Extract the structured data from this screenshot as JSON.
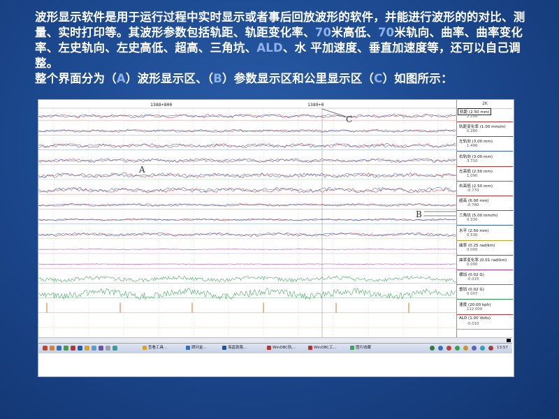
{
  "description": {
    "p1_a": "波形显示",
    "p1_b": "软件是用于运行过程中实时显示或者事后回放波形的软件，并能进行波形的的对比、测量、实时打印等。其波形参数包括轨距、轨距变化率、",
    "p1_c": "70",
    "p1_d": "米高低、",
    "p1_e": "70",
    "p1_f": "米轨向、曲率、曲率变化率、左史轨向、左史高低、超高、三角坑、",
    "p1_g": "ALD",
    "p1_h": "、水 平加速度、垂直加速度等，还可以自己调整。",
    "p2_a": "整个界面分为（",
    "p2_b": "A",
    "p2_c": "）波形显示区、（",
    "p2_d": "B",
    "p2_e": "）参数显示区和公里显示区（",
    "p2_f": "C",
    "p2_g": "）如图所示："
  },
  "screenshot": {
    "mileage_left": "1388+800",
    "mileage_right": "1389+0",
    "label_a": "A",
    "label_b": "B",
    "label_c": "C",
    "panel_header": "2K",
    "params": [
      {
        "label": "轨距 (2.50 mm)",
        "value": "2.150",
        "color": "#c03030"
      },
      {
        "label": "轨距变化率 (1.00 mm/m)",
        "value": "0.260",
        "color": "#c03030"
      },
      {
        "label": "左轨向 (3.00 mm)",
        "value": "1.490",
        "color": "#3060c0"
      },
      {
        "label": "右轨向 (3.00 mm)",
        "value": "3.710",
        "color": "#c03030"
      },
      {
        "label": "左高低 (2.50 mm)",
        "value": "1.090",
        "color": "#2a9a4a"
      },
      {
        "label": "右高低 (2.50 mm)",
        "value": "-0.770",
        "color": "#c03030"
      },
      {
        "label": "超高 (6.00 mm)",
        "value": "-0.780",
        "color": "#3060c0"
      },
      {
        "label": "三角坑 (5.00 mm/m)",
        "value": "0.330",
        "color": "#3060c0"
      },
      {
        "label": "水平 (2.50 mm)",
        "value": "0.530",
        "color": "#c9a020"
      },
      {
        "label": "曲率 (0.25 rad/km)",
        "value": "0.000",
        "color": "#a030a0"
      },
      {
        "label": "曲率变化率 (0.01 rad/km)",
        "value": "0.000",
        "color": "#a030a0"
      },
      {
        "label": "横加 (0.02 G)",
        "value": "-0.015",
        "color": "#2a9a4a"
      },
      {
        "label": "垂加 (0.02 G)",
        "value": "0.007",
        "color": "#2a9a4a"
      },
      {
        "label": "速度 (20.00 kph)",
        "value": "112.000",
        "color": "#c03030"
      },
      {
        "label": "ALD (1.00 Volts)",
        "value": "-0.010",
        "color": "#e0a030"
      }
    ],
    "taskbar": {
      "items": [
        "查看工具...",
        "顾问金...",
        "海昌铁路...",
        "WinDBC轨...",
        "WinDBC工...",
        "图片收藏"
      ],
      "clock": "13:57"
    }
  }
}
